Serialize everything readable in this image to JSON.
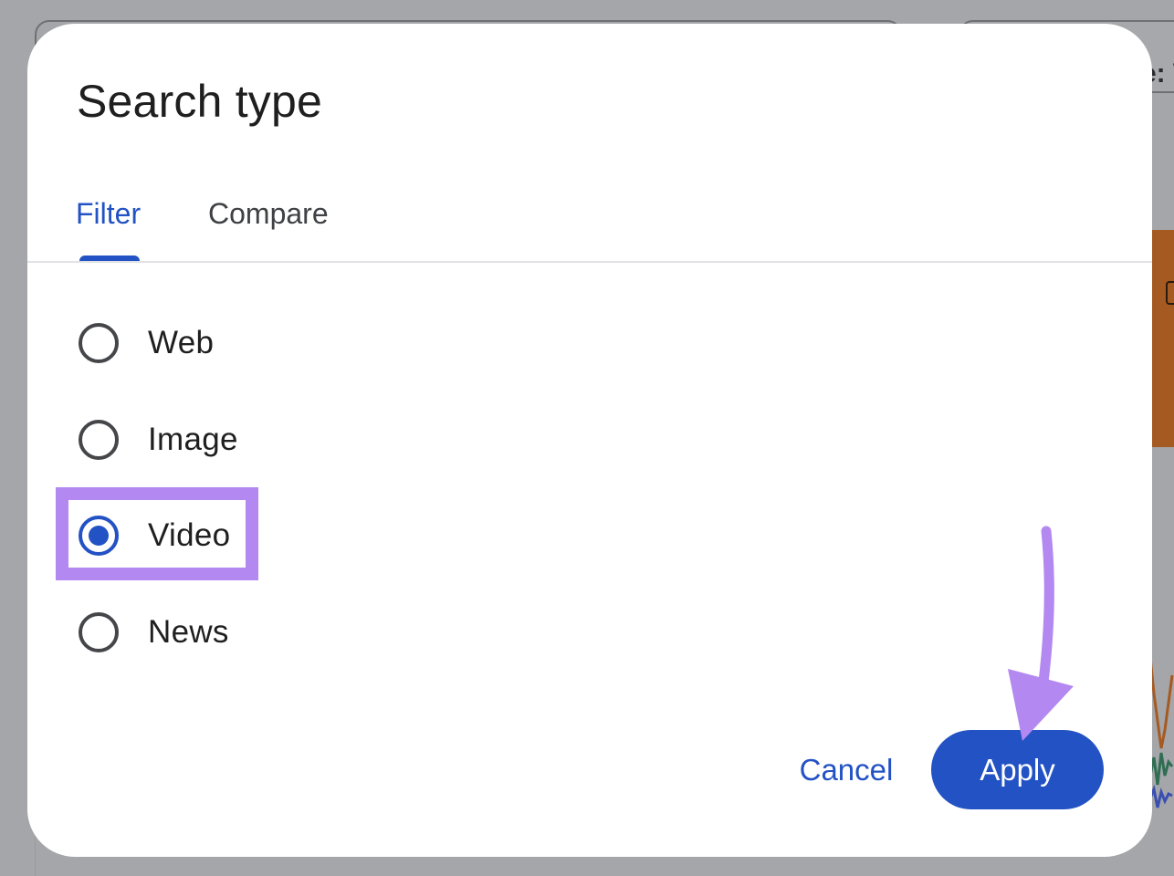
{
  "background": {
    "chip_text": "e: W"
  },
  "dialog": {
    "title": "Search type",
    "tabs": [
      {
        "label": "Filter",
        "selected": true
      },
      {
        "label": "Compare",
        "selected": false
      }
    ],
    "options": [
      {
        "label": "Web",
        "checked": false
      },
      {
        "label": "Image",
        "checked": false
      },
      {
        "label": "Video",
        "checked": true
      },
      {
        "label": "News",
        "checked": false
      }
    ],
    "cancel_label": "Cancel",
    "apply_label": "Apply"
  },
  "colors": {
    "accent": "#2352c4",
    "annotation": "#b388f0",
    "overlay": "#a5a6a9"
  }
}
